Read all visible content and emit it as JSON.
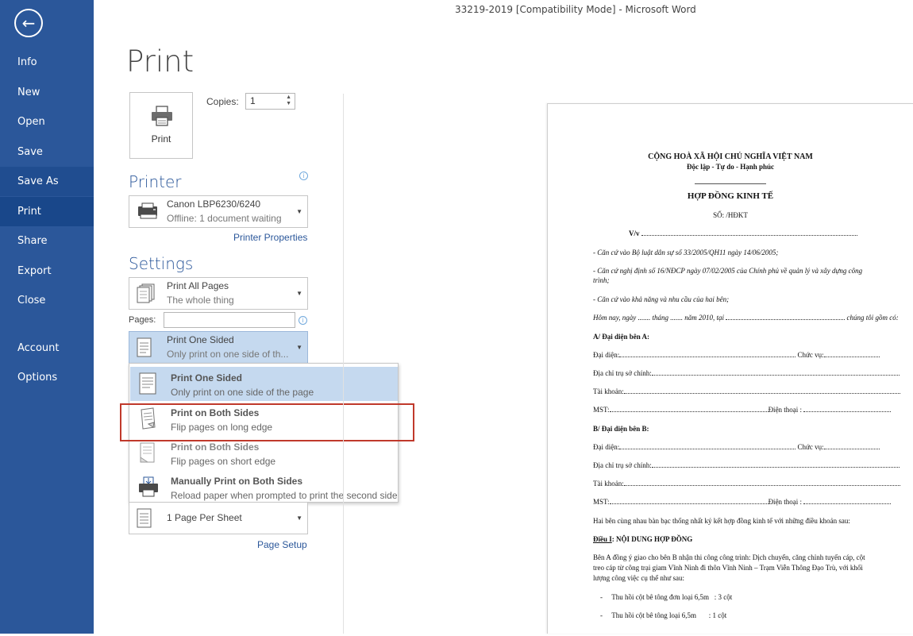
{
  "window": {
    "title": "33219-2019 [Compatibility Mode] - Microsoft Word"
  },
  "nav": {
    "back_icon": "back-arrow-icon",
    "items": [
      "Info",
      "New",
      "Open",
      "Save",
      "Save As",
      "Print",
      "Share",
      "Export",
      "Close",
      "Account",
      "Options"
    ],
    "active": "Print"
  },
  "print": {
    "heading": "Print",
    "button_label": "Print",
    "copies_label": "Copies:",
    "copies_value": "1"
  },
  "printer": {
    "title": "Printer",
    "name": "Canon LBP6230/6240",
    "status": "Offline: 1 document waiting",
    "properties_link": "Printer Properties"
  },
  "settings": {
    "title": "Settings",
    "range_main": "Print All Pages",
    "range_sub": "The whole thing",
    "pages_label": "Pages:",
    "pages_value": "",
    "sides_main": "Print One Sided",
    "sides_sub": "Only print on one side of th...",
    "per_sheet": "1 Page Per Sheet",
    "page_setup_link": "Page Setup"
  },
  "sides_menu": [
    {
      "title": "Print One Sided",
      "desc": "Only print on one side of the page"
    },
    {
      "title": "Print on Both Sides",
      "desc": "Flip pages on long edge"
    },
    {
      "title": "Print on Both Sides",
      "desc": "Flip pages on short edge"
    },
    {
      "title": "Manually Print on Both Sides",
      "desc": "Reload paper when prompted to print the second side"
    }
  ],
  "document": {
    "header1": "CỘNG HOÀ XÃ HỘI CHỦ NGHĨA VIỆT NAM",
    "header2": "Độc lập - Tự do - Hạnh phúc",
    "title": "HỢP ĐỒNG KINH TẾ",
    "number": "SỐ:    /HĐKT",
    "vv": "V/v",
    "basis1": "- Căn cứ vào Bộ luật dân sự số 33/2005/QH11 ngày 14/06/2005;",
    "basis2a": "- Căn cứ nghị định số 16/NĐCP ngày 07/02/2005 của Chính phủ về quản lý và xây dựng công",
    "basis2b": "trình;",
    "basis3": "- Căn cứ vào khả năng và nhu cầu của hai bên;",
    "today": "Hôm nay, ngày ....... tháng ....... năm 2010, tại",
    "today_end": "chúng tôi gồm có:",
    "partyA": "A/ Đại diện bên A:",
    "partyB": "B/ Đại diện bên B:",
    "rep": "Đại diện:",
    "position": "Chức vụ:",
    "address": "Địa chỉ trụ sở chính:",
    "account": "Tài khoản:",
    "tax": "MST:",
    "phone": "Điện thoại :",
    "agreement": "Hai bên cùng nhau bàn bạc thống nhất ký kết hợp đồng kinh tế với những điều khoản sau:",
    "article1_label": "Điều I",
    "article1_title": ": NỘI DUNG HỢP ĐỒNG",
    "body1": "Bên A đồng ý giao cho bên B nhận thi công công trình: Dịch chuyển, căng chỉnh tuyến cáp, cột",
    "body2": "treo cáp từ công trại giam Vĩnh Ninh đi thôn Vĩnh Ninh – Trạm Viễn Thông Đạo Trù, với khối",
    "body3": "lượng công việc cụ thể như sau:",
    "item1": "Thu hồi cột bê tông đơn loại 6,5m",
    "item1_qty": ": 3 cột",
    "item2": "Thu hồi cột bê tông loại 6,5m",
    "item2_qty": ": 1 cột"
  }
}
